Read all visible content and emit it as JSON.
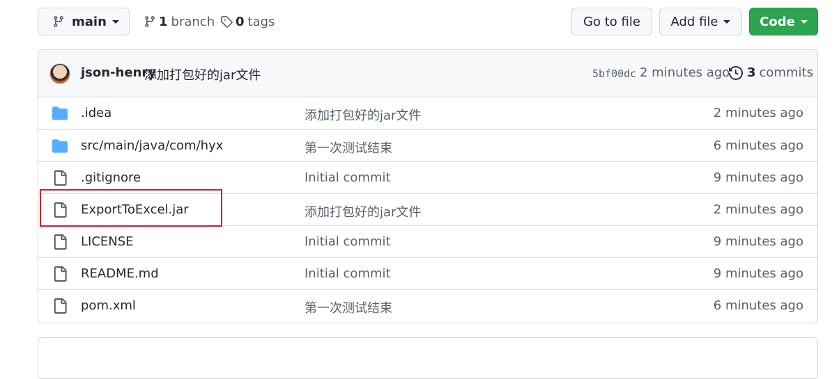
{
  "toolbar": {
    "branch_label": "main",
    "branches_count": "1",
    "branches_label": "branch",
    "tags_count": "0",
    "tags_label": "tags",
    "goto_label": "Go to file",
    "add_label": "Add file",
    "code_label": "Code"
  },
  "commit": {
    "author": "json-henry",
    "message": "添加打包好的jar文件",
    "hash": "5bf00dc",
    "time": "2 minutes ago",
    "commits_count": "3",
    "commits_label": "commits"
  },
  "files": [
    {
      "name": ".idea",
      "type": "folder",
      "message": "添加打包好的jar文件",
      "time": "2 minutes ago"
    },
    {
      "name": "src/main/java/com/hyx",
      "type": "folder",
      "message": "第一次测试结束",
      "time": "6 minutes ago"
    },
    {
      "name": ".gitignore",
      "type": "file",
      "message": "Initial commit",
      "time": "9 minutes ago"
    },
    {
      "name": "ExportToExcel.jar",
      "type": "file",
      "message": "添加打包好的jar文件",
      "time": "2 minutes ago"
    },
    {
      "name": "LICENSE",
      "type": "file",
      "message": "Initial commit",
      "time": "9 minutes ago"
    },
    {
      "name": "README.md",
      "type": "file",
      "message": "Initial commit",
      "time": "9 minutes ago"
    },
    {
      "name": "pom.xml",
      "type": "file",
      "message": "第一次测试结束",
      "time": "6 minutes ago"
    }
  ],
  "colors": {
    "folder": "#54aeff",
    "file_icon": "#57606a",
    "code_button": "#2da44e",
    "highlight": "#d0202f"
  },
  "icons": {
    "branch": "git-branch-icon",
    "tag": "tag-icon",
    "history": "history-icon",
    "folder": "folder-icon",
    "file": "file-icon"
  }
}
